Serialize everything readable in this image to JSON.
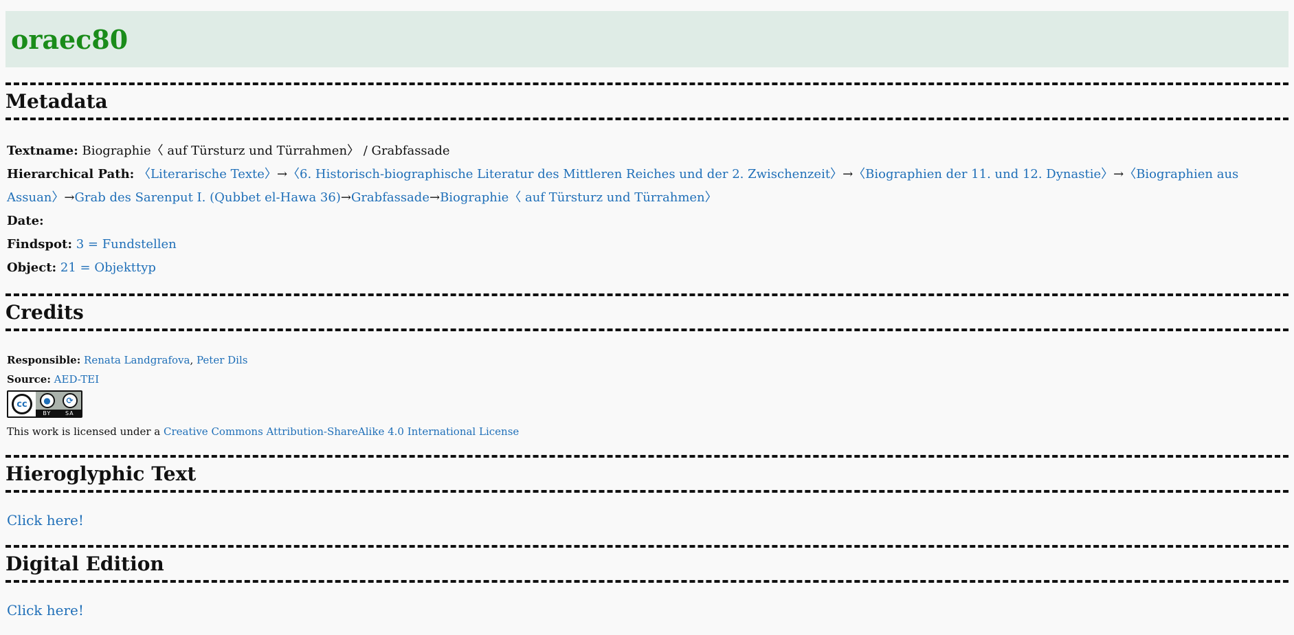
{
  "site_title": "oraec80",
  "sections": {
    "metadata": "Metadata",
    "credits": "Credits",
    "hieroglyphic": "Hieroglyphic Text",
    "digital": "Digital Edition"
  },
  "metadata": {
    "textname_label": "Textname:",
    "textname_value": "Biographie〈 auf Türsturz und Türrahmen〉 / Grabfassade",
    "path_label": "Hierarchical Path:",
    "path": [
      "〈Literarische Texte〉",
      "〈6. Historisch-biographische Literatur des Mittleren Reiches und der 2. Zwischenzeit〉",
      "〈Biographien der 11. und 12. Dynastie〉",
      "〈Biographien aus Assuan〉",
      "Grab des Sarenput I. (Qubbet el-Hawa 36)",
      "Grabfassade",
      "Biographie〈 auf Türsturz und Türrahmen〉"
    ],
    "arrow": "→",
    "date_label": "Date:",
    "findspot_label": "Findspot:",
    "findspot_value": "3 = Fundstellen",
    "object_label": "Object:",
    "object_value": "21 = Objekttyp"
  },
  "credits": {
    "responsible_label": "Responsible:",
    "responsible": [
      "Renata Landgrafova",
      "Peter Dils"
    ],
    "comma": ", ",
    "source_label": "Source:",
    "source": "AED-TEI",
    "license_badge": {
      "cc": "cc",
      "by": "BY",
      "sa": "SA"
    },
    "license_prefix": "This work is licensed under a ",
    "license_link": "Creative Commons Attribution-ShareAlike 4.0 International License"
  },
  "hieroglyphic_link": "Click here!",
  "digital_link": "Click here!"
}
